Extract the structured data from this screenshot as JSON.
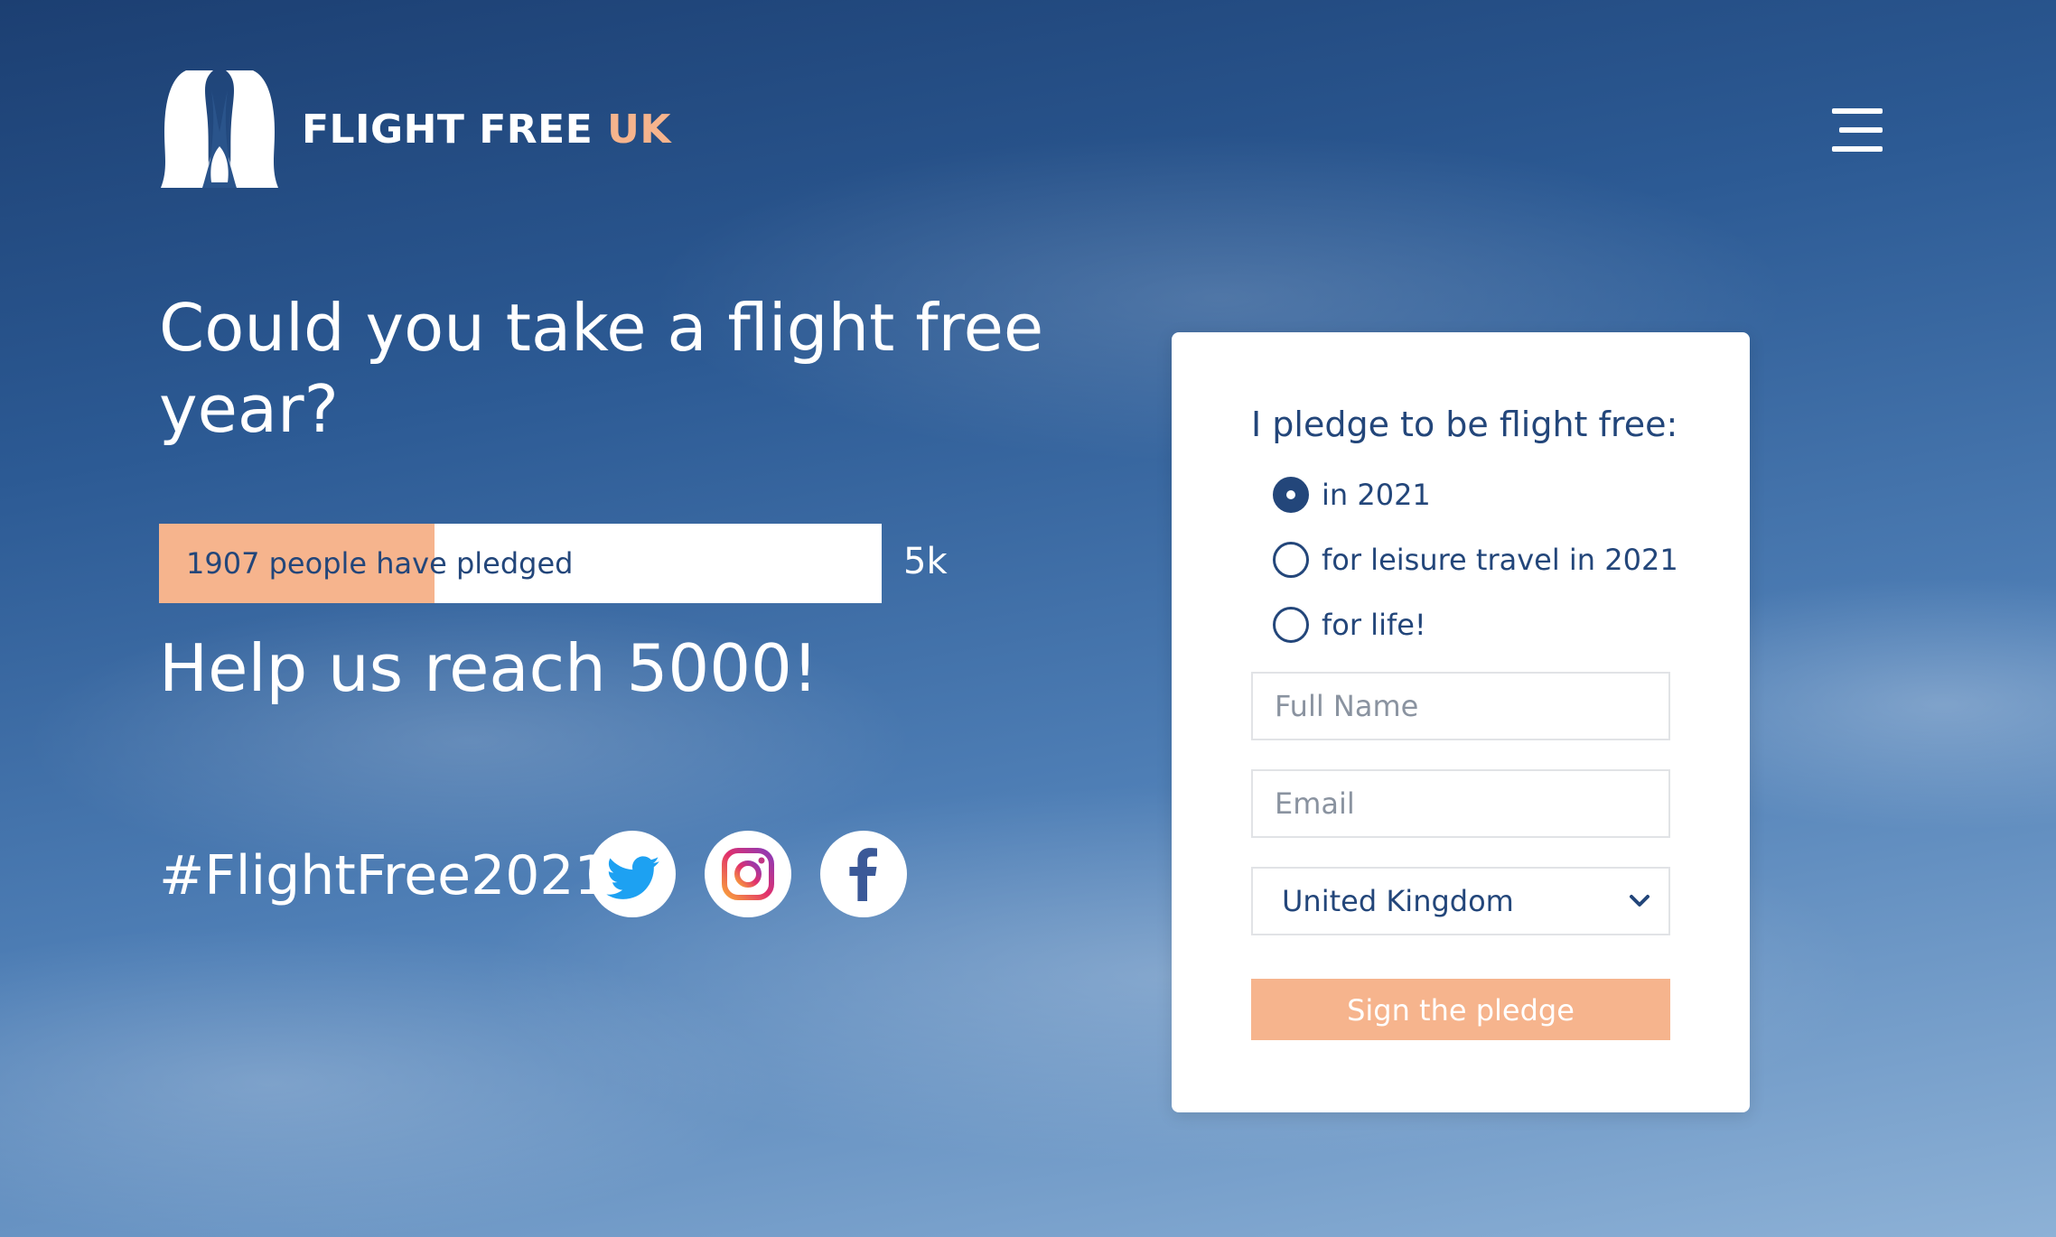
{
  "header": {
    "brand_main": "FLIGHT FREE",
    "brand_accent": "UK",
    "logo_icon": "penguins-logo-icon",
    "menu_icon": "hamburger-menu-icon"
  },
  "hero": {
    "headline_line1": "Could you take a flight free",
    "headline_line2": "year?",
    "progress_label": "1907 people have pledged",
    "pledged": 1907,
    "goal": 5000,
    "goal_short": "5k",
    "help_text": "Help us reach 5000!",
    "hashtag": "#FlightFree2021"
  },
  "social": [
    {
      "name": "twitter-icon",
      "color": "#1da1f2"
    },
    {
      "name": "instagram-icon",
      "color": "#c13584"
    },
    {
      "name": "facebook-icon",
      "color": "#3b5998"
    }
  ],
  "pledge_form": {
    "title": "I pledge to be flight free:",
    "options": [
      {
        "label": "in 2021",
        "selected": true
      },
      {
        "label": "for leisure travel in 2021",
        "selected": false
      },
      {
        "label": "for life!",
        "selected": false
      }
    ],
    "full_name_placeholder": "Full Name",
    "email_placeholder": "Email",
    "country": "United Kingdom",
    "submit_label": "Sign the pledge"
  },
  "colors": {
    "accent": "#f6b48d",
    "navy": "#23467a"
  }
}
